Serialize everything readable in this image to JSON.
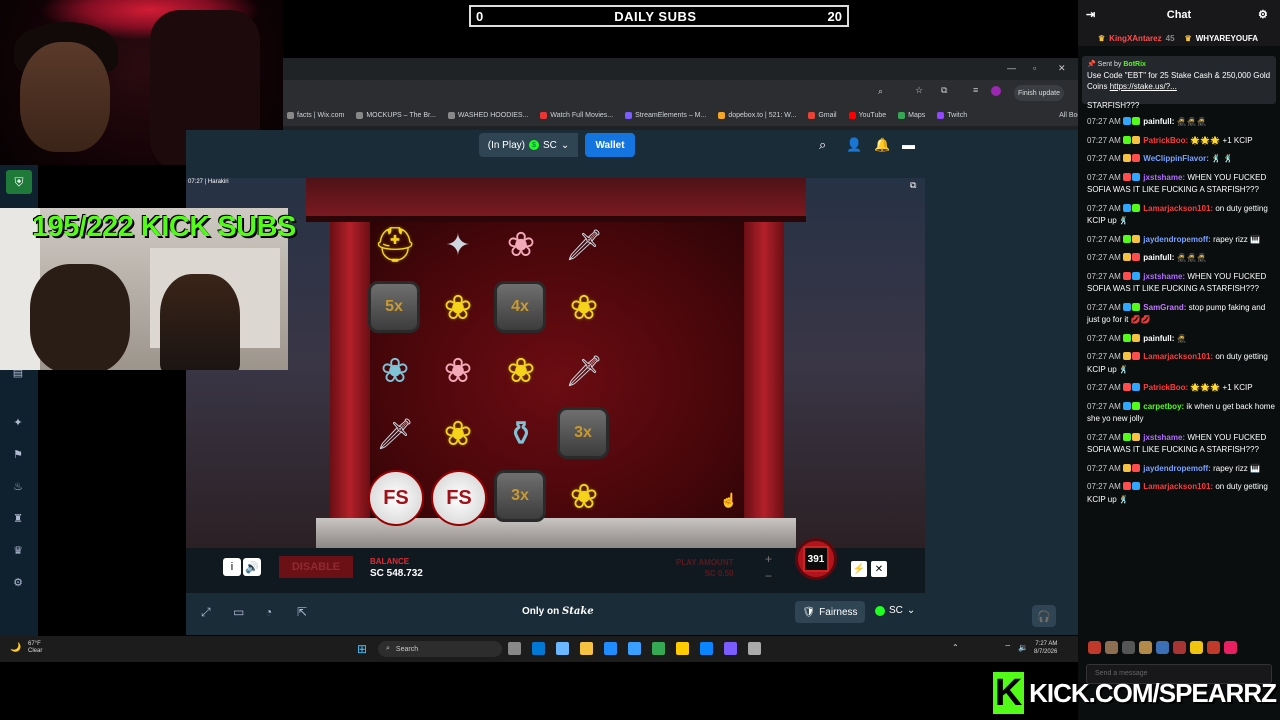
{
  "subs_bar": {
    "current": "0",
    "title": "DAILY SUBS",
    "goal": "20"
  },
  "overlay": {
    "kick_subs": "195/222 KICK SUBS",
    "kick_url": "KICK.COM/SPEARRZ",
    "kick_letter": "K"
  },
  "browser": {
    "finish_update": "Finish update",
    "bookmarks": [
      {
        "label": "facts | Wix.com",
        "color": "#888"
      },
      {
        "label": "MOCKUPS – The Br...",
        "color": "#888"
      },
      {
        "label": "WASHED HOODIES...",
        "color": "#888"
      },
      {
        "label": "Watch Full Movies...",
        "color": "#e33"
      },
      {
        "label": "StreamElements – M...",
        "color": "#7a5cff"
      },
      {
        "label": "dopebox.to | 521: W...",
        "color": "#f5a623"
      },
      {
        "label": "Gmail",
        "color": "#ea4335"
      },
      {
        "label": "YouTube",
        "color": "#f00"
      },
      {
        "label": "Maps",
        "color": "#34a853"
      },
      {
        "label": "Twitch",
        "color": "#9146ff"
      }
    ],
    "all_bookmarks": "All Bookmarks"
  },
  "stake": {
    "in_play": "(In Play)",
    "currency": "SC",
    "wallet": "Wallet",
    "game_title": "07:27 | Harakiri",
    "disable": "DISABLE",
    "balance_label": "BALANCE",
    "balance_value": "SC 548.732",
    "play_amount_label": "PLAY AMOUNT",
    "play_amount_value": "SC 0.50",
    "spin_count": "391",
    "only_on": "Only on",
    "brand": "Stake",
    "fairness": "Fairness",
    "footer_currency": "SC"
  },
  "grid": {
    "row1": [
      "helmet",
      "shuriken",
      "flower-p",
      "blade"
    ],
    "row2": [
      "5x",
      "flower-y",
      "4x",
      "flower-y"
    ],
    "row3": [
      "flower-b",
      "flower-p",
      "flower-y",
      "blade"
    ],
    "row4": [
      "blade",
      "flower-y",
      "potion",
      "3x"
    ],
    "row5": [
      "FS",
      "FS",
      "3x",
      "flower-y"
    ]
  },
  "taskbar": {
    "weather_temp": "67°F",
    "weather_desc": "Clear",
    "search": "Search",
    "time": "7:27 AM",
    "date": "8/7/2026"
  },
  "chat": {
    "title": "Chat",
    "top_user1": "KingXAntarez",
    "top_user1_count": "45",
    "top_user2": "WHYAREYOUFA",
    "pinned_by_label": "Sent by",
    "pinned_by": "BotRix",
    "pinned_text": "Use Code \"EBT\" for 25 Stake Cash & 250,000 Gold Coins",
    "pinned_link": "https://stake.us/?...",
    "pinned_tail": "STARFISH???",
    "input_placeholder": "Send a message",
    "messages": [
      {
        "time": "07:27 AM",
        "user": "painfull:",
        "color": "#ffffff",
        "text": "🥷🥷🥷"
      },
      {
        "time": "07:27 AM",
        "user": "PatrickBoo:",
        "color": "#ff3b3b",
        "text": "🌟🌟🌟 +1 KCIP"
      },
      {
        "time": "07:27 AM",
        "user": "WeClippinFlavor:",
        "color": "#7aa2ff",
        "text": "🕺 🕺"
      },
      {
        "time": "07:27 AM",
        "user": "jxstshame:",
        "color": "#b06cff",
        "text": "WHEN YOU FUCKED SOFIA WAS IT LIKE FUCKING A STARFISH???"
      },
      {
        "time": "07:27 AM",
        "user": "Lamarjackson101:",
        "color": "#ff3b3b",
        "text": "on duty getting KCIP up 🕺"
      },
      {
        "time": "07:27 AM",
        "user": "jaydendropemoff:",
        "color": "#7aa2ff",
        "text": "rapey rizz 🎹"
      },
      {
        "time": "07:27 AM",
        "user": "painfull:",
        "color": "#ffffff",
        "text": "🥷🥷🥷"
      },
      {
        "time": "07:27 AM",
        "user": "jxstshame:",
        "color": "#b06cff",
        "text": "WHEN YOU FUCKED SOFIA WAS IT LIKE FUCKING A STARFISH???"
      },
      {
        "time": "07:27 AM",
        "user": "SamGrand:",
        "color": "#c07bff",
        "text": "stop pump faking and just go for it 💋💋"
      },
      {
        "time": "07:27 AM",
        "user": "painfull:",
        "color": "#ffffff",
        "text": "🥷"
      },
      {
        "time": "07:27 AM",
        "user": "Lamarjackson101:",
        "color": "#ff3b3b",
        "text": "on duty getting KCIP up 🕺"
      },
      {
        "time": "07:27 AM",
        "user": "PatrickBoo:",
        "color": "#ff3b3b",
        "text": "🌟🌟🌟 +1 KCIP"
      },
      {
        "time": "07:27 AM",
        "user": "carpetboy:",
        "color": "#53fc18",
        "text": "ik when u get back home she yo new jolly"
      },
      {
        "time": "07:27 AM",
        "user": "jxstshame:",
        "color": "#b06cff",
        "text": "WHEN YOU FUCKED SOFIA WAS IT LIKE FUCKING A STARFISH???"
      },
      {
        "time": "07:27 AM",
        "user": "jaydendropemoff:",
        "color": "#7aa2ff",
        "text": "rapey rizz 🎹"
      },
      {
        "time": "07:27 AM",
        "user": "Lamarjackson101:",
        "color": "#ff3b3b",
        "text": "on duty getting KCIP up 🕺"
      }
    ]
  }
}
